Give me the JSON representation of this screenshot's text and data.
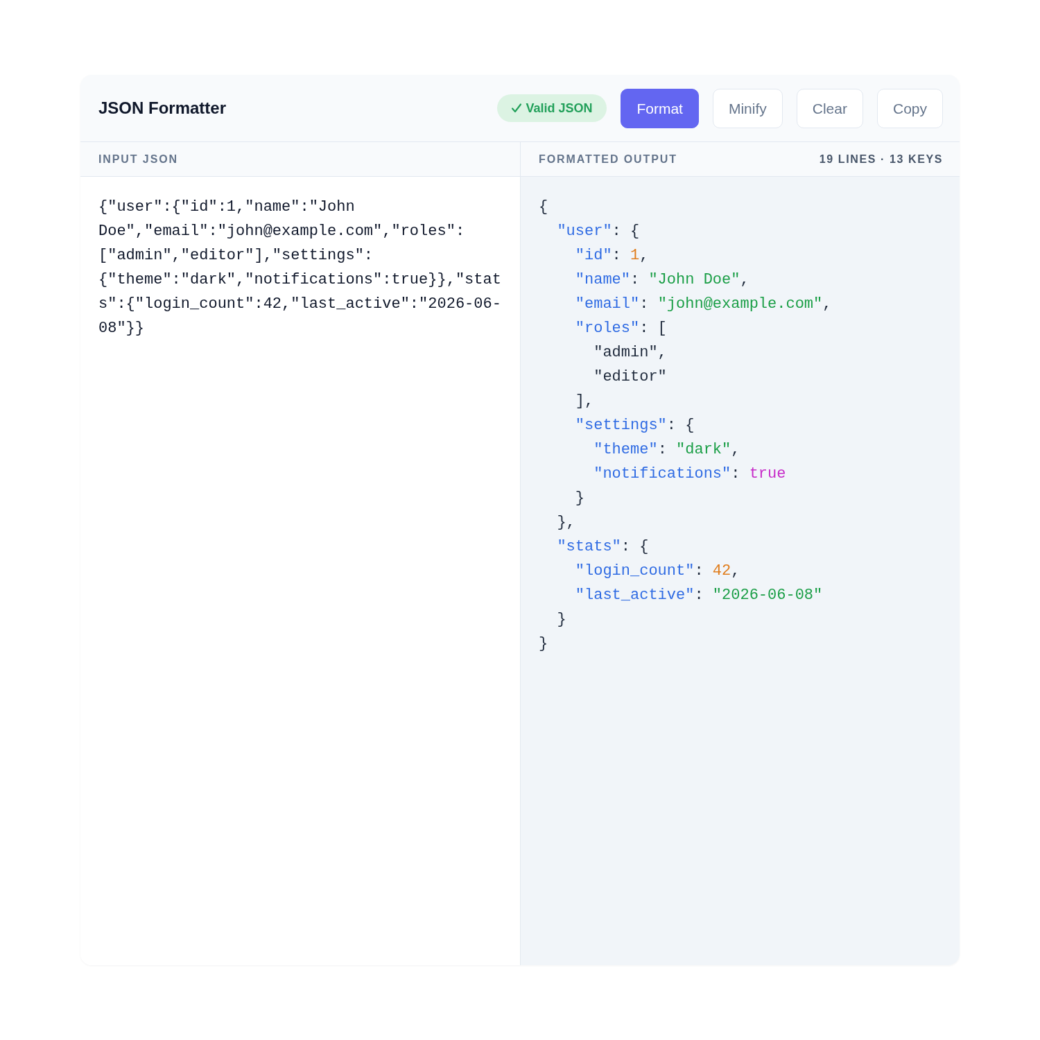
{
  "header": {
    "title": "JSON Formatter",
    "status": {
      "kind": "valid",
      "label": "Valid JSON"
    },
    "buttons": [
      {
        "label": "Format",
        "kind": "primary"
      },
      {
        "label": "Minify",
        "kind": "secondary"
      },
      {
        "label": "Clear",
        "kind": "secondary"
      },
      {
        "label": "Copy",
        "kind": "secondary"
      }
    ]
  },
  "input_panel": {
    "heading": "INPUT JSON",
    "value": "{\"user\":{\"id\":1,\"name\":\"John Doe\",\"email\":\"john@example.com\",\"roles\":[\"admin\",\"editor\"],\"settings\":{\"theme\":\"dark\",\"notifications\":true}},\"stats\":{\"login_count\":42,\"last_active\":\"2026-06-08\"}}"
  },
  "output_panel": {
    "heading": "FORMATTED OUTPUT",
    "summary": "19 LINES · 13 KEYS",
    "lines": [
      {
        "tokens": [
          {
            "kind": "punct",
            "text": "{"
          }
        ],
        "children": [
          {
            "tokens": [
              {
                "kind": "key",
                "text": "\"user\""
              },
              {
                "kind": "punct",
                "text": ": {"
              }
            ],
            "children": [
              {
                "tokens": [
                  {
                    "kind": "key",
                    "text": "\"id\""
                  },
                  {
                    "kind": "punct",
                    "text": ": "
                  },
                  {
                    "kind": "number",
                    "text": "1"
                  },
                  {
                    "kind": "punct",
                    "text": ","
                  }
                ]
              },
              {
                "tokens": [
                  {
                    "kind": "key",
                    "text": "\"name\""
                  },
                  {
                    "kind": "punct",
                    "text": ": "
                  },
                  {
                    "kind": "string",
                    "text": "\"John Doe\""
                  },
                  {
                    "kind": "punct",
                    "text": ","
                  }
                ]
              },
              {
                "tokens": [
                  {
                    "kind": "key",
                    "text": "\"email\""
                  },
                  {
                    "kind": "punct",
                    "text": ": "
                  },
                  {
                    "kind": "string",
                    "text": "\"john@example.com\""
                  },
                  {
                    "kind": "punct",
                    "text": ","
                  }
                ]
              },
              {
                "tokens": [
                  {
                    "kind": "key",
                    "text": "\"roles\""
                  },
                  {
                    "kind": "punct",
                    "text": ": ["
                  }
                ],
                "children": [
                  {
                    "tokens": [
                      {
                        "kind": "punct",
                        "text": "\"admin\","
                      }
                    ]
                  },
                  {
                    "tokens": [
                      {
                        "kind": "punct",
                        "text": "\"editor\""
                      }
                    ]
                  }
                ],
                "close": [
                  {
                    "kind": "punct",
                    "text": "],"
                  }
                ]
              },
              {
                "tokens": [
                  {
                    "kind": "key",
                    "text": "\"settings\""
                  },
                  {
                    "kind": "punct",
                    "text": ": {"
                  }
                ],
                "children": [
                  {
                    "tokens": [
                      {
                        "kind": "key",
                        "text": "\"theme\""
                      },
                      {
                        "kind": "punct",
                        "text": ": "
                      },
                      {
                        "kind": "string",
                        "text": "\"dark\""
                      },
                      {
                        "kind": "punct",
                        "text": ","
                      }
                    ]
                  },
                  {
                    "tokens": [
                      {
                        "kind": "key",
                        "text": "\"notifications\""
                      },
                      {
                        "kind": "punct",
                        "text": ": "
                      },
                      {
                        "kind": "boolean",
                        "text": "true"
                      }
                    ]
                  }
                ],
                "close": [
                  {
                    "kind": "punct",
                    "text": "}"
                  }
                ]
              }
            ],
            "close": [
              {
                "kind": "punct",
                "text": "},"
              }
            ]
          },
          {
            "tokens": [
              {
                "kind": "key",
                "text": "\"stats\""
              },
              {
                "kind": "punct",
                "text": ": {"
              }
            ],
            "children": [
              {
                "tokens": [
                  {
                    "kind": "key",
                    "text": "\"login_count\""
                  },
                  {
                    "kind": "punct",
                    "text": ": "
                  },
                  {
                    "kind": "number",
                    "text": "42"
                  },
                  {
                    "kind": "punct",
                    "text": ","
                  }
                ]
              },
              {
                "tokens": [
                  {
                    "kind": "key",
                    "text": "\"last_active\""
                  },
                  {
                    "kind": "punct",
                    "text": ": "
                  },
                  {
                    "kind": "string",
                    "text": "\"2026-06-08\""
                  }
                ]
              }
            ],
            "close": [
              {
                "kind": "punct",
                "text": "}"
              }
            ]
          }
        ],
        "close": [
          {
            "kind": "punct",
            "text": "}"
          }
        ]
      }
    ]
  }
}
